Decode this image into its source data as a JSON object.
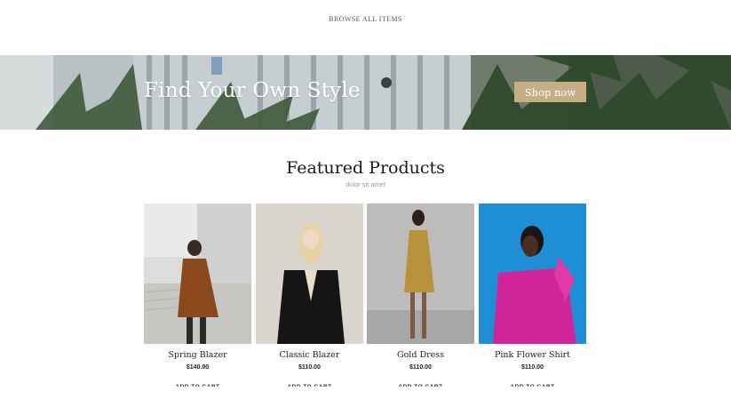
{
  "nav": {
    "browse_all_label": "BROWSE ALL ITEMS"
  },
  "hero": {
    "title": "Find Your Own Style",
    "cta_label": "Shop now"
  },
  "featured": {
    "title": "Featured Products",
    "subtitle": "dolor sit amet",
    "products": [
      {
        "name": "Spring Blazer",
        "price": "$140.00",
        "action": "ADD TO CART"
      },
      {
        "name": "Classic Blazer",
        "price": "$110.00",
        "action": "ADD TO CART"
      },
      {
        "name": "Gold Dress",
        "price": "$110.00",
        "action": "ADD TO CART"
      },
      {
        "name": "Pink Flower Shirt",
        "price": "$110.00",
        "action": "ADD TO CART"
      }
    ]
  },
  "colors": {
    "cta": "#c6ad85",
    "photo4_bg": "#1e8fd6"
  }
}
